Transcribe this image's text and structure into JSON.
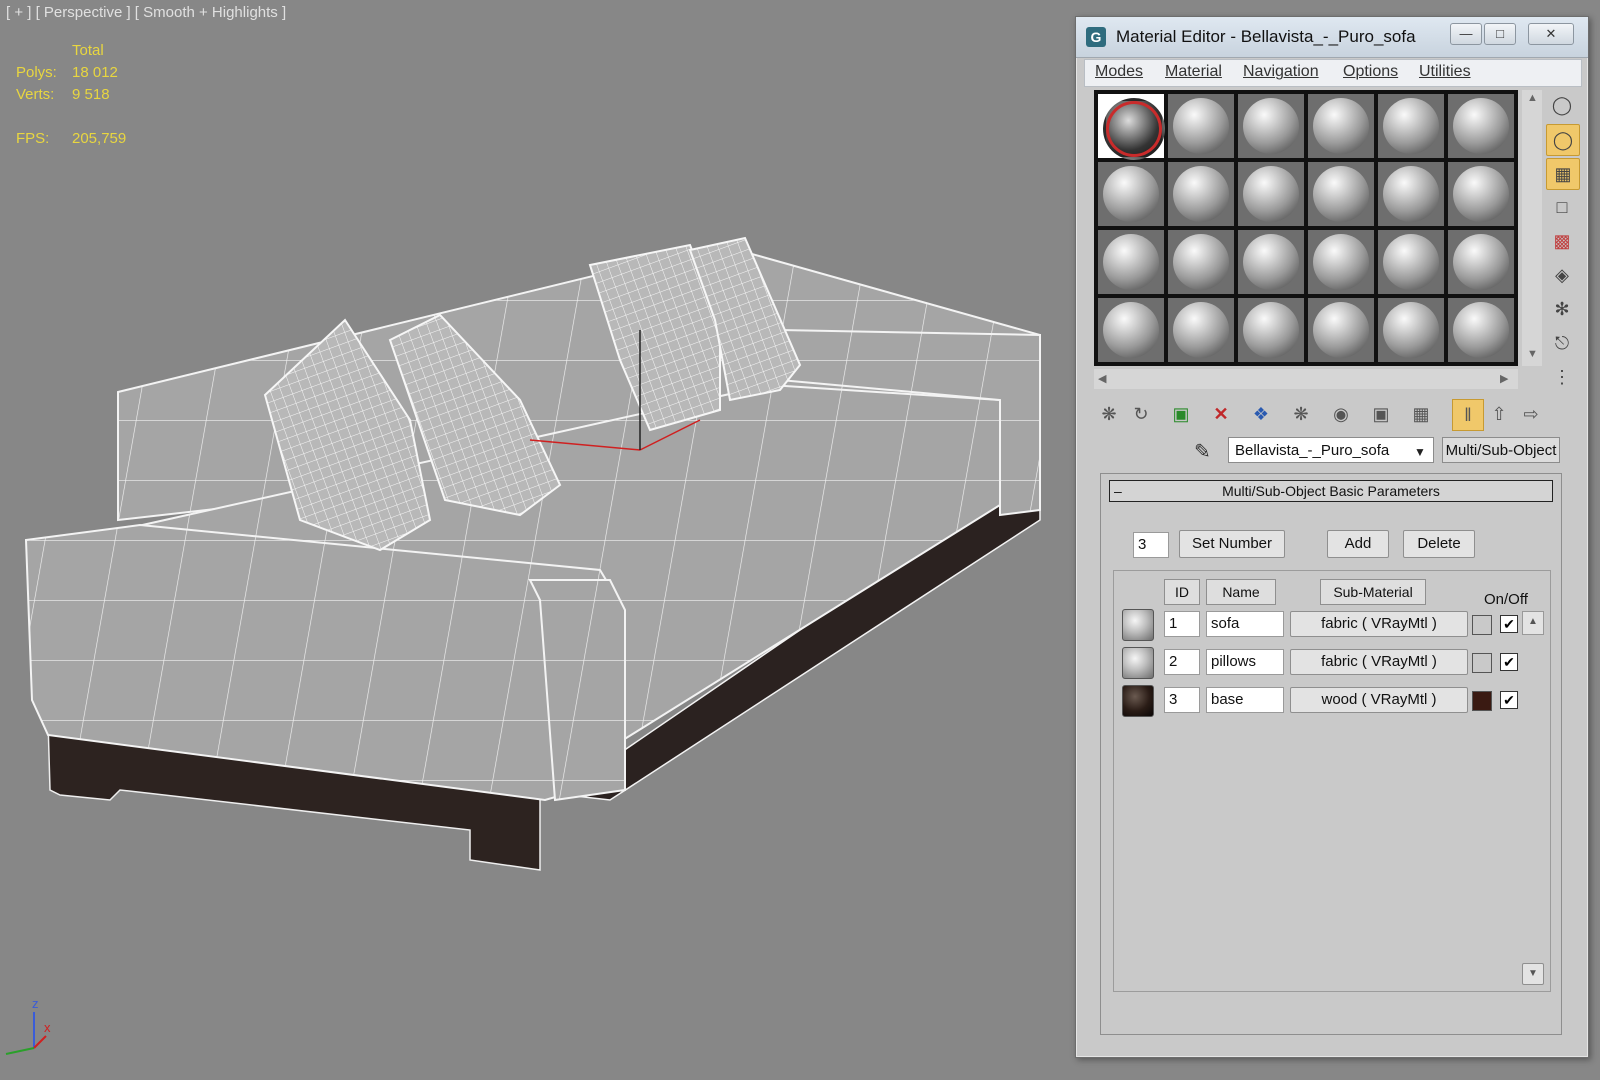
{
  "viewport": {
    "label": "[ + ] [ Perspective ] [ Smooth + Highlights ]",
    "stats": {
      "total_label": "Total",
      "polys_label": "Polys:",
      "polys_value": "18 012",
      "verts_label": "Verts:",
      "verts_value": "9 518",
      "fps_label": "FPS:",
      "fps_value": "205,759"
    },
    "axis": {
      "x": "x",
      "y": "y",
      "z": "z"
    }
  },
  "material_editor": {
    "title": "Material Editor - Bellavista_-_Puro_sofa",
    "window_buttons": {
      "minimize": "—",
      "maximize": "□",
      "close": "✕"
    },
    "menu": [
      "Modes",
      "Material",
      "Navigation",
      "Options",
      "Utilities"
    ],
    "material_name": "Bellavista_-_Puro_sofa",
    "material_type": "Multi/Sub-Object",
    "rollout_title": "Multi/Sub-Object Basic Parameters",
    "rollout_toggle": "–",
    "number_value": "3",
    "buttons": {
      "set_number": "Set Number",
      "add": "Add",
      "delete": "Delete"
    },
    "headers": {
      "id": "ID",
      "name": "Name",
      "sub_material": "Sub-Material",
      "on_off": "On/Off"
    },
    "rows": [
      {
        "id": "1",
        "name": "sofa",
        "sub_material": "fabric  ( VRayMtl )",
        "color": "#c9c9c9",
        "checked": "✔"
      },
      {
        "id": "2",
        "name": "pillows",
        "sub_material": "fabric  ( VRayMtl )",
        "color": "#c9c9c9",
        "checked": "✔"
      },
      {
        "id": "3",
        "name": "base",
        "sub_material": "wood  ( VRayMtl )",
        "color": "#3a1a12",
        "checked": "✔"
      }
    ]
  },
  "colors": {
    "viewport_bg": "#878787",
    "stats_text": "#e8d640",
    "highlight": "#f0c86a"
  }
}
